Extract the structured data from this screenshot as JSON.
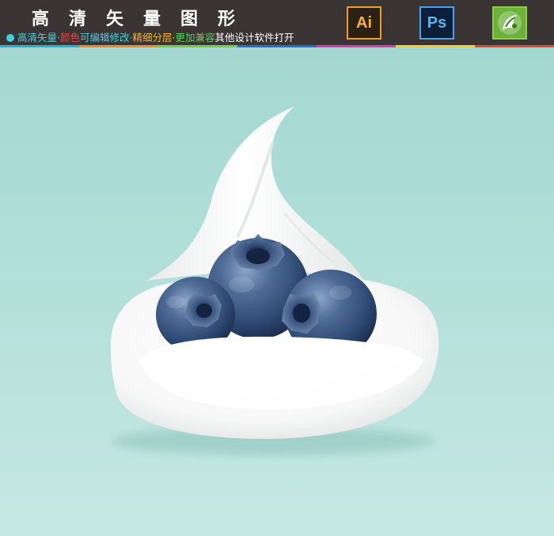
{
  "header": {
    "title": "高清矢量图形",
    "tagline": [
      {
        "text": "高清矢量·",
        "color": "#3fd0e0"
      },
      {
        "text": "颜色",
        "color": "#e84545"
      },
      {
        "text": "可编辑修改·",
        "color": "#3fd0e0"
      },
      {
        "text": "精细分层·",
        "color": "#f0b23a"
      },
      {
        "text": "更加兼容",
        "color": "#5ad15a"
      },
      {
        "text": "其他设计软件打开",
        "color": "#ffffff"
      }
    ],
    "bullet_color": "#3fd0e0",
    "stripe_colors": [
      "#1fb5d8",
      "#f08a1e",
      "#6bd13a",
      "#1e6fd8",
      "#d83ab5",
      "#f0d21e",
      "#e8452f"
    ]
  },
  "apps": [
    {
      "name": "illustrator",
      "label": "Ai",
      "icon": "illustrator-icon"
    },
    {
      "name": "photoshop",
      "label": "Ps",
      "icon": "photoshop-icon"
    },
    {
      "name": "coreldraw",
      "label": "",
      "icon": "coreldraw-icon"
    }
  ],
  "illustration": {
    "subject": [
      "whipped-cream",
      "blueberry",
      "blueberry",
      "blueberry"
    ],
    "background_color": "#a8dcd5",
    "cream_color": "#fbfbfb",
    "berry_color": "#3d5a86"
  }
}
